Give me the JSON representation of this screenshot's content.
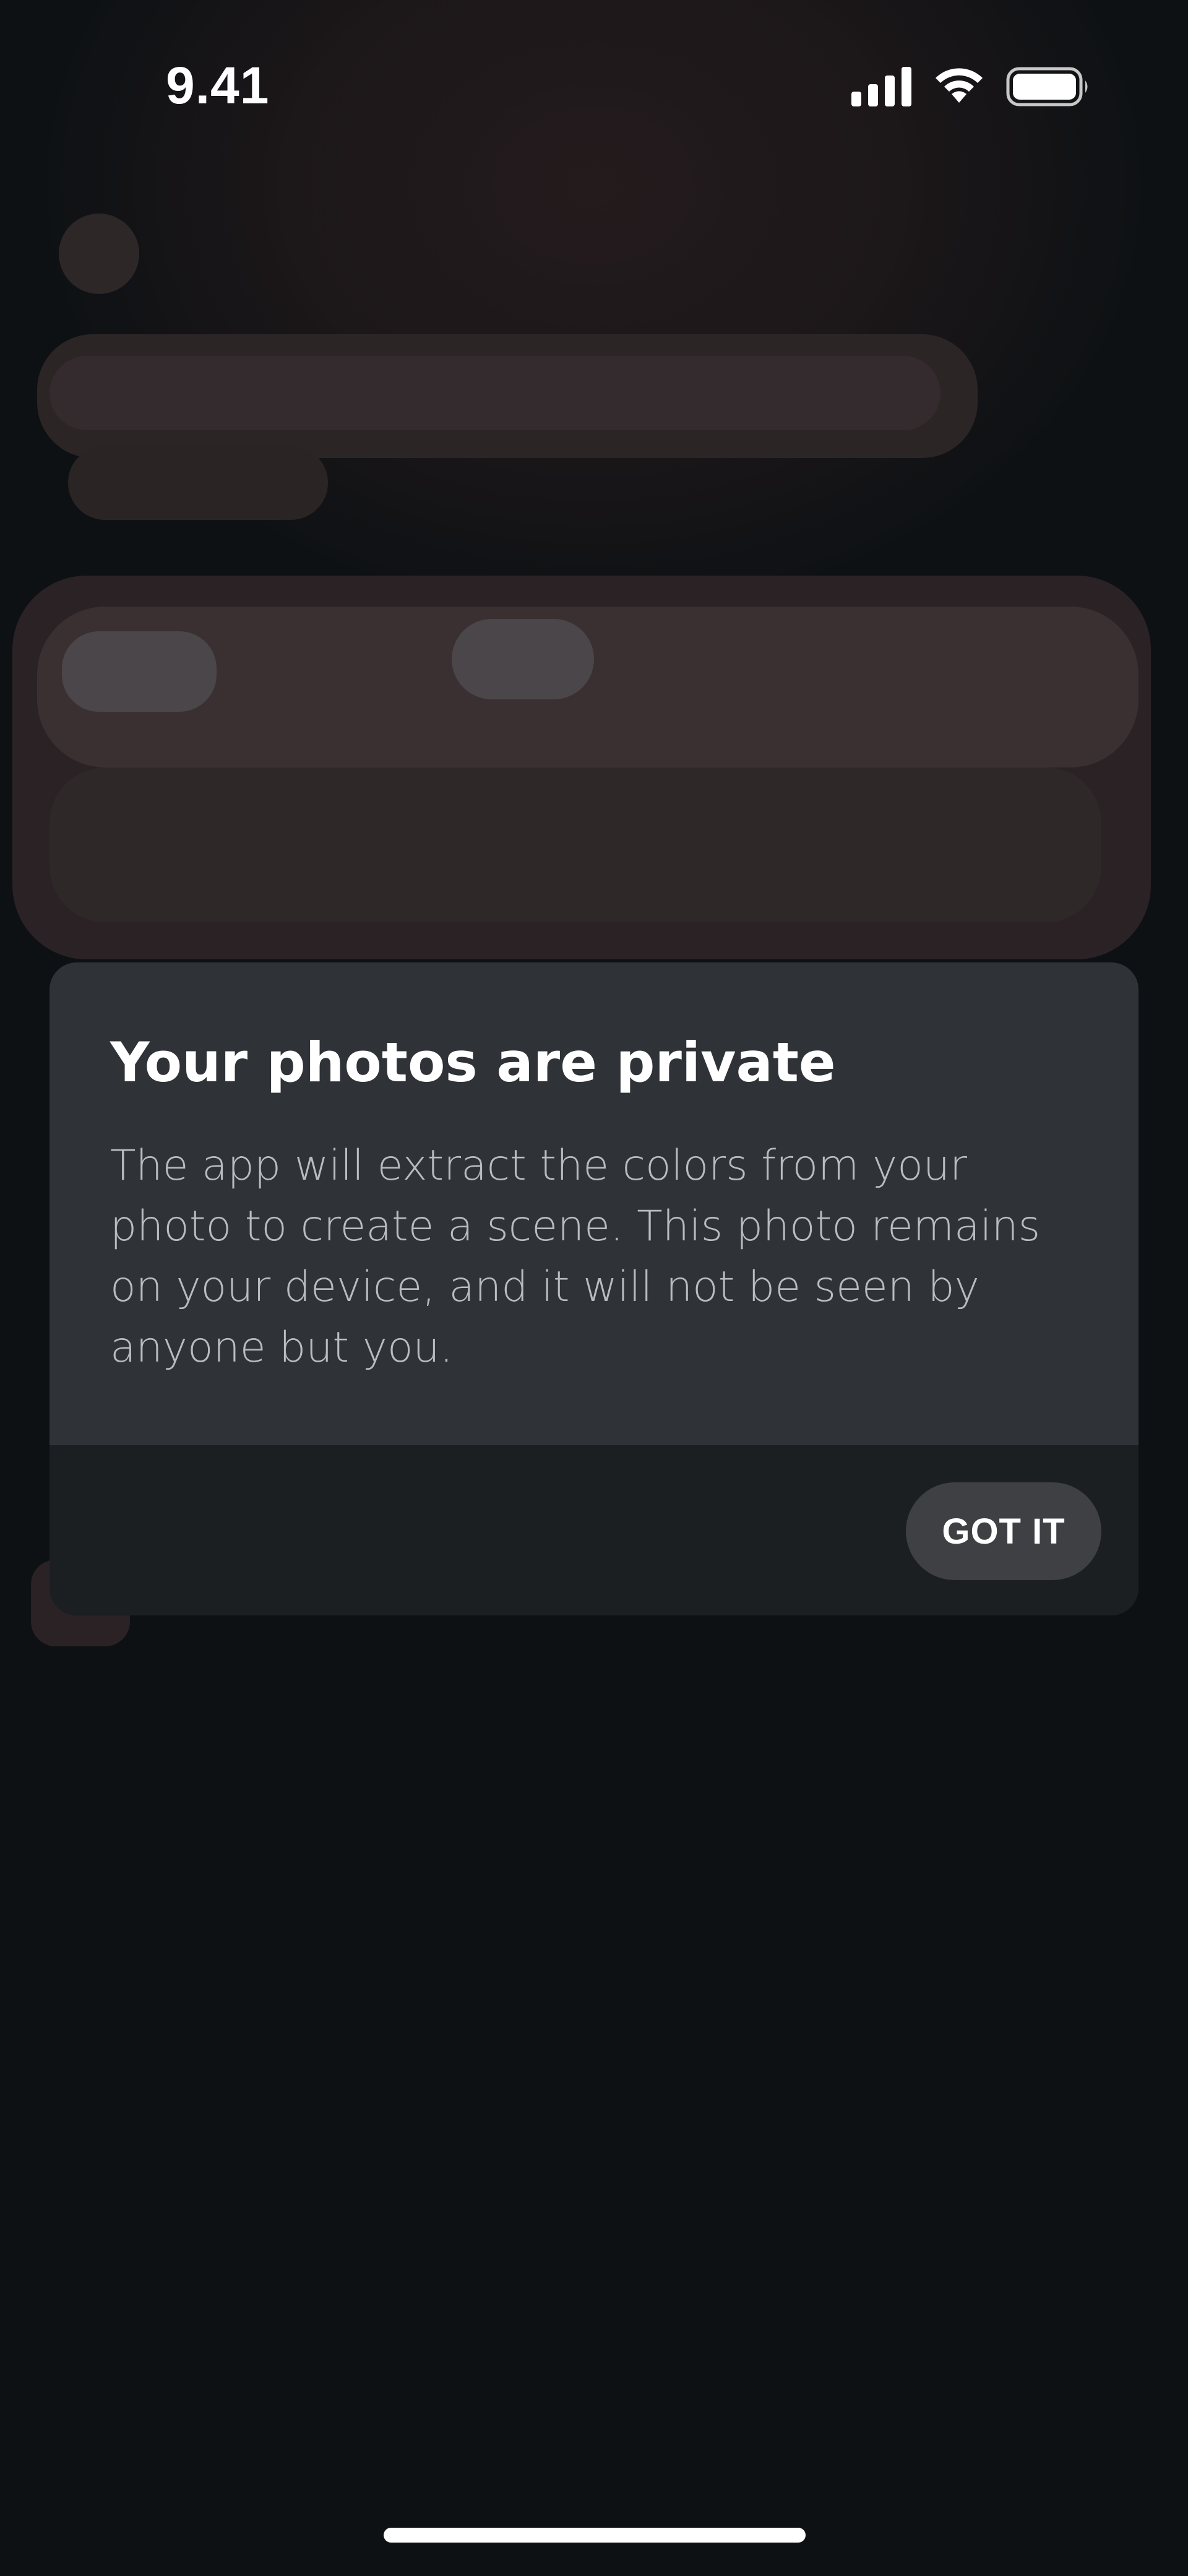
{
  "status_bar": {
    "time": "9.41",
    "icons": [
      "cellular-signal-icon",
      "wifi-icon",
      "battery-icon"
    ]
  },
  "dialog": {
    "title": "Your photos are private",
    "message": "The app will extract the colors from your photo to create a scene. This photo remains on your device, and it will not be seen by anyone but you.",
    "button_label": "GOT IT"
  },
  "colors": {
    "background": "#0e1114",
    "dialog_body": "#2f3337",
    "dialog_footer": "#1b1f22",
    "button": "#3e4043",
    "text_primary": "#ffffff",
    "text_secondary": "#b9bcbf"
  }
}
